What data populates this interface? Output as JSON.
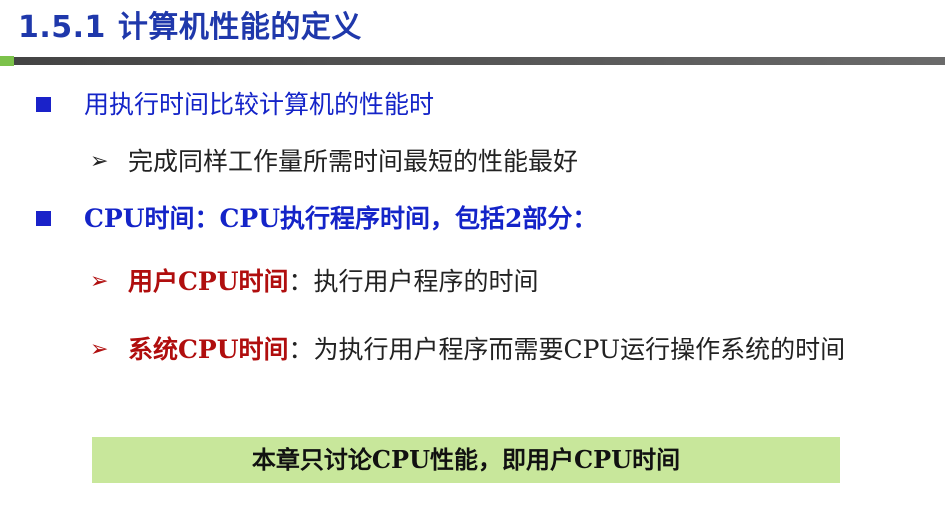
{
  "title": {
    "number": "1.5.1",
    "text": "计算机性能的定义"
  },
  "bullets": {
    "b1": {
      "text": "用执行时间比较计算机的性能时",
      "sub": "完成同样工作量所需时间最短的性能最好"
    },
    "b2": {
      "text": "CPU时间：CPU执行程序时间，包括2部分："
    },
    "b3": {
      "term": "用户CPU时间",
      "colon": "：",
      "desc": "执行用户程序的时间"
    },
    "b4": {
      "term": "系统CPU时间",
      "colon": "：",
      "desc": "为执行用户程序而需要CPU运行操作系统的时间"
    }
  },
  "note": "本章只讨论CPU性能，即用户CPU时间",
  "colors": {
    "title_blue": "#1f38ab",
    "bullet_blue": "#1424c8",
    "term_red": "#b00e0e",
    "accent_green": "#7cc24b",
    "note_bg": "#c8e79b"
  },
  "icons": {
    "bullet_square": "square-bullet-icon",
    "bullet_arrow": "arrow-bullet-icon"
  }
}
